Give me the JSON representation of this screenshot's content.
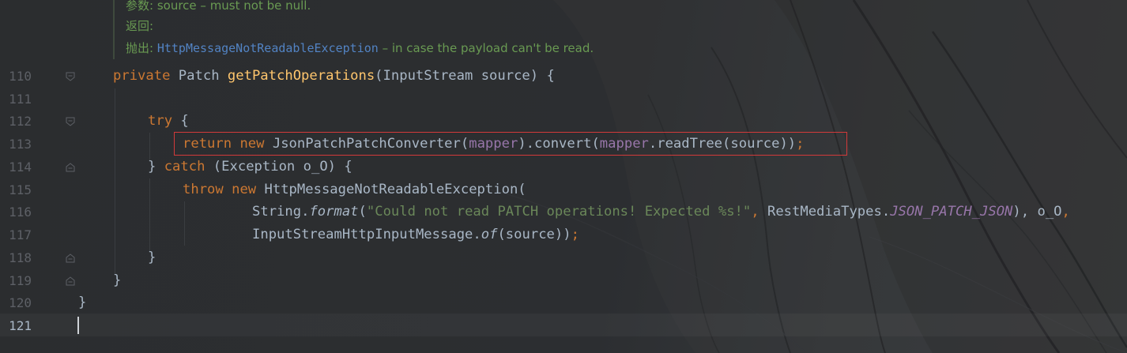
{
  "doc": {
    "params_label": "参数:",
    "params_text": "source – must not be null.",
    "returns_label": "返回:",
    "throws_label": "抛出:",
    "throws_ref": "HttpMessageNotReadableException",
    "throws_text": "– in case the payload can't be read."
  },
  "line_numbers": [
    "110",
    "111",
    "112",
    "113",
    "114",
    "115",
    "116",
    "117",
    "118",
    "119",
    "120",
    "121"
  ],
  "code": {
    "l110_private": "private",
    "l110_patch": "Patch",
    "l110_method": "getPatchOperations",
    "l110_sig": "(InputStream source) {",
    "l112_try": "try",
    "l112_brace": " {",
    "l113_return": "return",
    "l113_new": "new",
    "l113_class": "JsonPatchPatchConverter(",
    "l113_mapper1": "mapper",
    "l113_convert": ").convert(",
    "l113_mapper2": "mapper",
    "l113_rest": ".readTree(source))",
    "l113_semi": ";",
    "l114_close": "} ",
    "l114_catch": "catch",
    "l114_rest": " (Exception o_O) {",
    "l115_throw": "throw",
    "l115_new": "new",
    "l115_rest": "HttpMessageNotReadableException(",
    "l116_string": "String.",
    "l116_format": "format",
    "l116_paren": "(",
    "l116_literal": "\"Could not read PATCH operations! Expected %s!\"",
    "l116_comma": ",",
    "l116_types": "RestMediaTypes.",
    "l116_const": "JSON_PATCH_JSON",
    "l116_close": "),",
    "l116_var": "o_O",
    "l116_end": ",",
    "l117_class": "InputStreamHttpInputMessage.",
    "l117_of": "of",
    "l117_rest": "(source))",
    "l117_semi": ";",
    "l118": "}",
    "l119": "}",
    "l120": "}"
  },
  "colors": {
    "keyword": "#cc7832",
    "method": "#ffc66d",
    "field": "#9876aa",
    "string": "#6a8759",
    "highlight_border": "#d23a3a"
  }
}
